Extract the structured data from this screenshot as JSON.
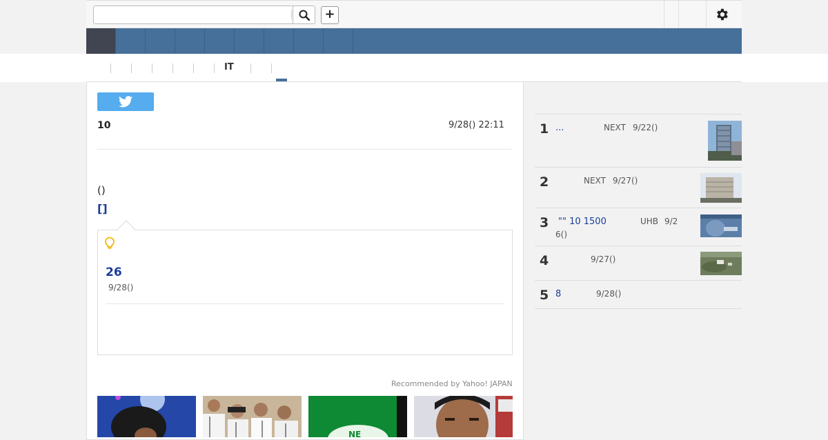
{
  "header": {
    "search": {
      "placeholder": "",
      "value": ""
    },
    "plus_label": "+",
    "icons": [
      "search-icon",
      "gear-icon"
    ]
  },
  "subnav": {
    "active_label": "IT"
  },
  "article": {
    "tweet_icon": "twitter-icon",
    "count_label": "10",
    "timestamp": "9/28() 22:11",
    "paren": "()",
    "bracket": "[]",
    "callout": {
      "icon": "lightbulb-icon",
      "number": "26",
      "date": "9/28()"
    },
    "recommended": "Recommended by Yahoo! JAPAN"
  },
  "ranking": [
    {
      "rank": "1",
      "link": "...",
      "source": "NEXT",
      "date": "9/22()"
    },
    {
      "rank": "2",
      "link": "",
      "source": "NEXT",
      "date": "9/27()"
    },
    {
      "rank": "3",
      "link": "\"\" 10 1500",
      "source": "UHB",
      "date": "9/2",
      "date_wrap": "6()"
    },
    {
      "rank": "4",
      "link": "",
      "source": "",
      "date": "9/27()"
    },
    {
      "rank": "5",
      "link": "8",
      "source": "",
      "date": "9/28()"
    }
  ],
  "colors": {
    "nav": "#466f99",
    "nav_active": "#404551",
    "link": "#1a3c99",
    "twitter": "#55acee"
  }
}
